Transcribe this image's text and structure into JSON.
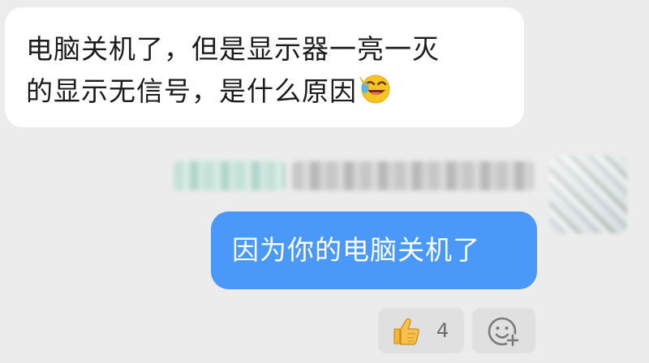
{
  "incoming_message": {
    "line1": "电脑关机了，但是显示器一亮一灭",
    "line2": "的显示无信号，是什么原因",
    "emoji": "laughing-face-emoji"
  },
  "sender": {
    "name_redacted": "",
    "meta_redacted": ""
  },
  "outgoing_message": {
    "text": "因为你的电脑关机了"
  },
  "reactions": {
    "like": {
      "icon": "thumbs-up-icon",
      "count": "4"
    },
    "add": {
      "icon": "add-reaction-icon"
    }
  },
  "colors": {
    "background": "#ececec",
    "incoming_bubble": "#ffffff",
    "outgoing_bubble": "#4a98f7",
    "reaction_bg": "#e0e0e0"
  }
}
